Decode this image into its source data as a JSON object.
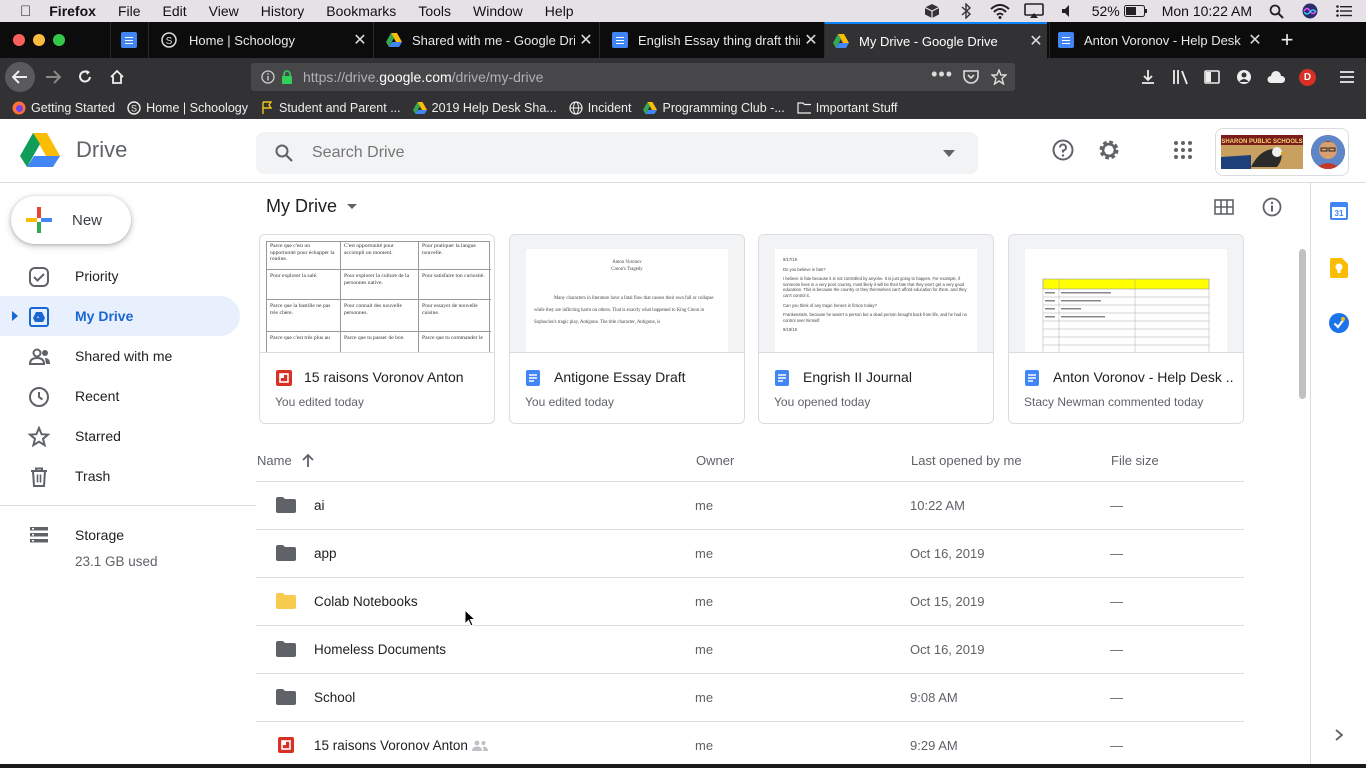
{
  "menubar": {
    "app": "Firefox",
    "items": [
      "File",
      "Edit",
      "View",
      "History",
      "Bookmarks",
      "Tools",
      "Window",
      "Help"
    ],
    "battery": "52%",
    "clock": "Mon 10:22 AM"
  },
  "tabs": [
    {
      "label": "Home | Schoology"
    },
    {
      "label": "Shared with me - Google Drive"
    },
    {
      "label": "English Essay thing draft thing"
    },
    {
      "label": "My Drive - Google Drive"
    },
    {
      "label": "Anton Voronov - Help Desk Log"
    }
  ],
  "url": {
    "prefix": "https://drive.",
    "domain": "google.com",
    "path": "/drive/my-drive"
  },
  "bookmarks": [
    "Getting Started",
    "Home | Schoology",
    "Student and Parent ...",
    "2019 Help Desk Sha...",
    "Incident",
    "Programming Club -...",
    "Important Stuff"
  ],
  "drive": {
    "logo_text": "Drive",
    "search_placeholder": "Search Drive",
    "profile_label": "SHARON PUBLIC SCHOOLS"
  },
  "sidebar": {
    "new_label": "New",
    "items": [
      {
        "label": "Priority",
        "icon": "priority-icon"
      },
      {
        "label": "My Drive",
        "icon": "my-drive-icon"
      },
      {
        "label": "Shared with me",
        "icon": "shared-icon"
      },
      {
        "label": "Recent",
        "icon": "clock-icon"
      },
      {
        "label": "Starred",
        "icon": "star-icon"
      },
      {
        "label": "Trash",
        "icon": "trash-icon"
      }
    ],
    "storage_label": "Storage",
    "storage_used": "23.1 GB used"
  },
  "main": {
    "title": "My Drive",
    "quick_access": [
      {
        "name": "15 raisons Voronov Anton",
        "sub": "You edited today",
        "type": "slides"
      },
      {
        "name": "Antigone Essay Draft",
        "sub": "You edited today",
        "type": "doc"
      },
      {
        "name": "Engrish II Journal",
        "sub": "You opened today",
        "type": "doc"
      },
      {
        "name": "Anton Voronov - Help Desk ...",
        "sub": "Stacy Newman commented today",
        "type": "doc"
      }
    ],
    "thumb_text": {
      "slides": [
        "Parce que c'est un opportunité pour échapper la routine.",
        "C'est opportunité pour accompli un moment.",
        "Pour pratiquer la langue nouvelle.",
        "Pour explorer la salé.",
        "Pour explorer la culture de la personnes native.",
        "Pour satisfaire ton curiosité.",
        "Parce que la bastille ne pas très chère.",
        "Pour connait des nouvelle personnes.",
        "Pour essayer de nouvelle cuisine.",
        "Parce que c'est très plus au",
        "Parce que tu passer de bon",
        "Parce que tu commander le"
      ],
      "essay_author": "Anton Voronov",
      "essay_title": "Creon's Tragedy",
      "essay_body": "Many characters in literature have a fatal flaw that causes their own fall or collapse while they are inflicting harm on others. That is exactly what happened to King Creon in Sophocles's tragic play, Antigone. The title character, Antigone, is",
      "journal": [
        "9/17/19",
        "Do you believe in fate?",
        "I believe in fate because it is not controlled by anyone. It is just going to happen. For example, if someone lives in a very poor country, most likely it will be their fate that they won't get a very good education. This is because the country or they themselves can't afford education for them, and they can't control it.",
        "Can you think of any tragic heroes in fiction today?",
        "Frankenstein, because he wasn't a person but a dead person brought back from life, and he had no control over himself.",
        "9/19/19"
      ]
    },
    "columns": {
      "name": "Name",
      "owner": "Owner",
      "opened": "Last opened by me",
      "size": "File size"
    },
    "rows": [
      {
        "name": "ai",
        "owner": "me",
        "opened": "10:22 AM",
        "size": "—",
        "type": "folder-grey"
      },
      {
        "name": "app",
        "owner": "me",
        "opened": "Oct 16, 2019",
        "size": "—",
        "type": "folder-grey"
      },
      {
        "name": "Colab Notebooks",
        "owner": "me",
        "opened": "Oct 15, 2019",
        "size": "—",
        "type": "folder-yellow"
      },
      {
        "name": "Homeless Documents",
        "owner": "me",
        "opened": "Oct 16, 2019",
        "size": "—",
        "type": "folder-grey"
      },
      {
        "name": "School",
        "owner": "me",
        "opened": "9:08 AM",
        "size": "—",
        "type": "folder-grey"
      },
      {
        "name": "15 raisons Voronov Anton",
        "owner": "me",
        "opened": "9:29 AM",
        "size": "—",
        "type": "slides"
      }
    ]
  },
  "colors": {
    "blue": "#4285f4",
    "slides_red": "#d93025",
    "folder_grey": "#5f6368",
    "folder_yellow": "#f7cb4d",
    "selected_bg": "#e8f0fe"
  }
}
